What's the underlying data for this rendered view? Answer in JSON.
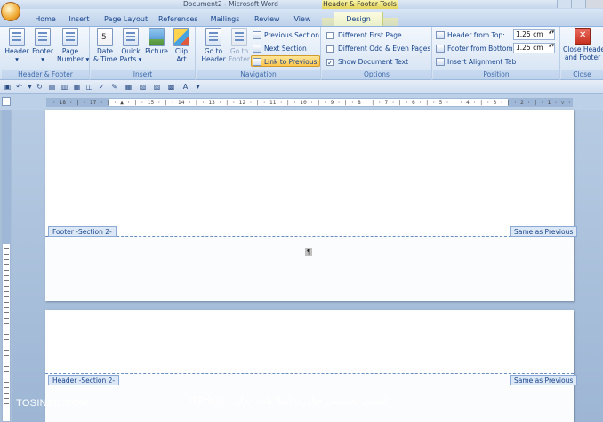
{
  "window": {
    "title": "Document2 - Microsoft Word",
    "contextual_title": "Header & Footer Tools"
  },
  "tabs": [
    {
      "label": "Home"
    },
    {
      "label": "Insert"
    },
    {
      "label": "Page Layout"
    },
    {
      "label": "References"
    },
    {
      "label": "Mailings"
    },
    {
      "label": "Review"
    },
    {
      "label": "View"
    },
    {
      "label": "Design"
    }
  ],
  "ribbon": {
    "groups": {
      "header_footer": {
        "label": "Header & Footer",
        "header": "Header",
        "footer": "Footer",
        "page_number_line1": "Page",
        "page_number_line2": "Number"
      },
      "insert": {
        "label": "Insert",
        "date_line1": "Date",
        "date_line2": "& Time",
        "quick_line1": "Quick",
        "quick_line2": "Parts",
        "picture": "Picture",
        "clip_line1": "Clip",
        "clip_line2": "Art"
      },
      "navigation": {
        "label": "Navigation",
        "goto_header_line1": "Go to",
        "goto_header_line2": "Header",
        "goto_footer_line1": "Go to",
        "goto_footer_line2": "Footer",
        "previous_section": "Previous Section",
        "next_section": "Next Section",
        "link_to_previous": "Link to Previous"
      },
      "options": {
        "label": "Options",
        "different_first_page": "Different First Page",
        "different_odd_even": "Different Odd & Even Pages",
        "show_document_text": "Show Document Text"
      },
      "position": {
        "label": "Position",
        "header_from_top": "Header from Top:",
        "header_from_top_value": "1.25 cm",
        "footer_from_bottom": "Footer from Bottom:",
        "footer_from_bottom_value": "1.25 cm",
        "insert_alignment_tab": "Insert Alignment Tab"
      },
      "close": {
        "label": "Close",
        "close_line1": "Close Header",
        "close_line2": "and Footer"
      }
    }
  },
  "ruler": {
    "ticks": "· 18 · | · 17 · | · ▲ · | · 15 · | · 14 · | · 13 · | · 12 · | · 11 · | · 10 · | · 9 · | · 8 · | · 7 · | · 6 · | · 5 · | · 4 · | · 3 · | · 2 · | · 1 · ▽ · | · 1 · | · 2 ·"
  },
  "document": {
    "footer_section_tag": "Footer -Section 2-",
    "footer_same_as_previous": "Same as Previous",
    "header_section_tag": "Header -Section 2-",
    "header_same_as_previous": "Same as Previous",
    "paragraph_mark": "¶"
  },
  "watermark": {
    "left": "TOSINSO.COM",
    "center": "ITPro.ir - انجمن تخصصی فناوری اطلاعات ایران"
  },
  "colors": {
    "ribbon_text": "#15428b",
    "contextual_tab": "#f3e885",
    "active_button": "#ffc64c"
  }
}
